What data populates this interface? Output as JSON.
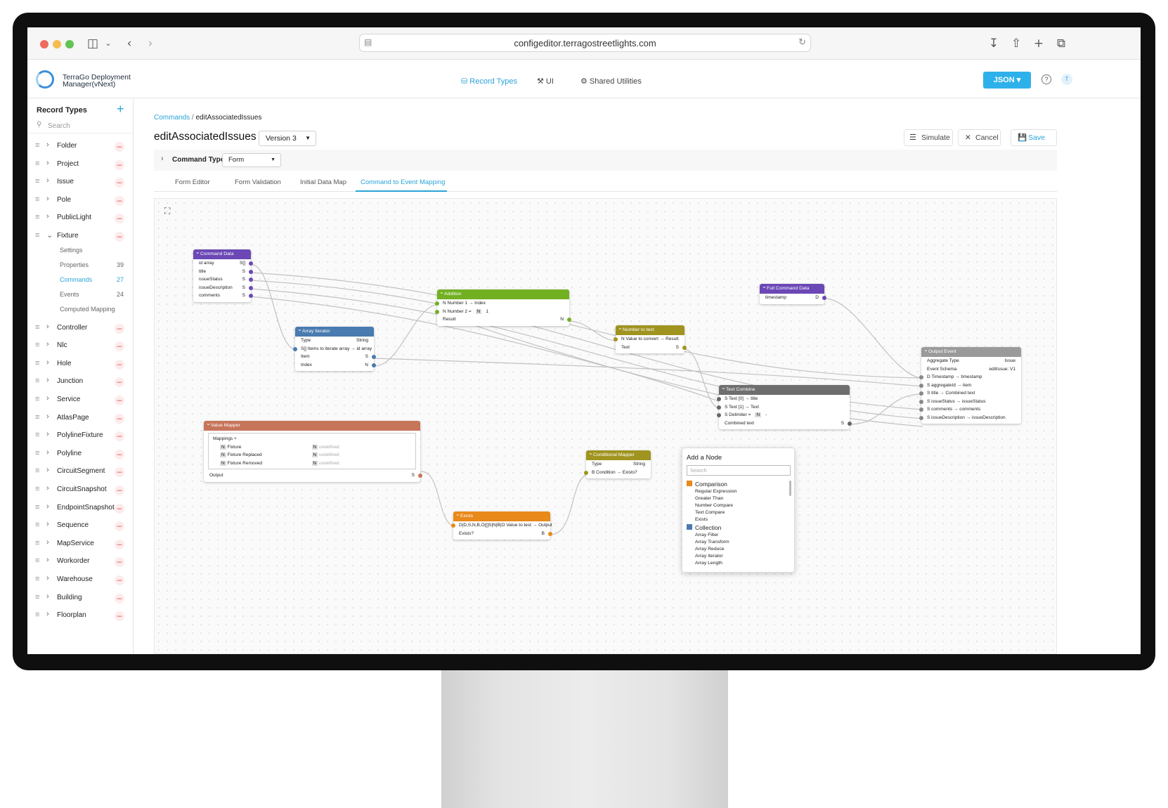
{
  "browser": {
    "url": "configeditor.terragostreetlights.com"
  },
  "app": {
    "brand_line1": "TerraGo Deployment",
    "brand_line2": "Manager(vNext)",
    "nav": [
      "Record Types",
      "UI",
      "Shared Utilities"
    ],
    "json_label": "JSON",
    "avatar": "T"
  },
  "sidebar": {
    "title": "Record Types",
    "search_placeholder": "Search",
    "items": [
      "Folder",
      "Project",
      "Issue",
      "Pole",
      "PublicLight",
      "Fixture"
    ],
    "fixture_children": [
      {
        "label": "Settings",
        "count": ""
      },
      {
        "label": "Properties",
        "count": "39"
      },
      {
        "label": "Commands",
        "count": "27"
      },
      {
        "label": "Events",
        "count": "24"
      },
      {
        "label": "Computed Mapping",
        "count": ""
      }
    ],
    "items_after": [
      "Controller",
      "Nlc",
      "Hole",
      "Junction",
      "Service",
      "AtlasPage",
      "PolylineFixture",
      "Polyline",
      "CircuitSegment",
      "CircuitSnapshot",
      "EndpointSnapshot",
      "Sequence",
      "MapService",
      "Workorder",
      "Warehouse",
      "Building",
      "Floorplan"
    ]
  },
  "main": {
    "breadcrumb_root": "Commands",
    "breadcrumb_sep": " / ",
    "breadcrumb_leaf": "editAssociatedIssues",
    "title": "editAssociatedIssues",
    "version": "Version 3",
    "simulate": "Simulate",
    "cancel": "Cancel",
    "save": "Save",
    "command_type_label": "Command Type",
    "command_type_value": "Form",
    "tabs": [
      "Form Editor",
      "Form Validation",
      "Initial Data Map",
      "Command to Event Mapping"
    ]
  },
  "nodes": {
    "command_data": {
      "title": "Command Data",
      "rows": [
        [
          "id array",
          "S[]"
        ],
        [
          "title",
          "S"
        ],
        [
          "issueStatus",
          "S"
        ],
        [
          "issueDescription",
          "S"
        ],
        [
          "comments",
          "S"
        ]
      ]
    },
    "array_iterator": {
      "title": "Array Iterator",
      "type_label": "Type",
      "type_value": "String",
      "items_row": "S[]  Items to iterate array → id array",
      "rows": [
        [
          "Item",
          "S"
        ],
        [
          "Index",
          "N"
        ]
      ]
    },
    "addition": {
      "title": "Addition",
      "r1": "N   Number 1 → Index",
      "r2_label": "N   Number 2 =",
      "r2_badge": "N",
      "r2_value": "1",
      "result": "Result",
      "result_type": "N"
    },
    "number_to_text": {
      "title": "Number to text",
      "r1": "N   Value to convert → Result",
      "r2": "Text",
      "r2_type": "S"
    },
    "full_command": {
      "title": "Full Command Data",
      "r1": "timestamp",
      "r1_type": "D"
    },
    "text_combine": {
      "title": "Text Combine",
      "r1": "S   Text [0] → title",
      "r2": "S   Text [1] → Text",
      "r3": "S   Delimiter =",
      "r3_badge": "N",
      "r3_value": "-",
      "r4": "Combined text",
      "r4_type": "S"
    },
    "output_event": {
      "title": "Output Event",
      "agg_label": "Aggregate Type",
      "agg_value": "Issue",
      "schema_label": "Event Schema",
      "schema_value": "editIssue: V1",
      "rows": [
        "D   Timestamp → timestamp",
        "S   aggregateId → item",
        "S   title → Combined text",
        "S   issueStatus → issueStatus",
        "S   comments → comments",
        "S   issueDescription → issueDescription"
      ]
    },
    "value_mapper": {
      "title": "Value Mapper",
      "mappings_label": "Mappings +",
      "rows": [
        {
          "badge": "N",
          "value": "Fixture",
          "badge2": "N",
          "value2": "undefined"
        },
        {
          "badge": "N",
          "value": "Fixture Replaced",
          "badge2": "N",
          "value2": "undefined"
        },
        {
          "badge": "N",
          "value": "Fixture Removed",
          "badge2": "N",
          "value2": "undefined"
        }
      ],
      "output": "Output",
      "output_type": "S"
    },
    "conditional": {
      "title": "Conditional Mapper",
      "type_label": "Type",
      "type_value": "String",
      "r1": "B   Condition → Exists?"
    },
    "exists": {
      "title": "Exists",
      "r1": "D|D,S,N,B,O|[]S|N|B|O   Value to test → Output",
      "r2": "Exists?",
      "r2_type": "B"
    }
  },
  "add_node": {
    "title": "Add a Node",
    "search_placeholder": "Search",
    "groups": [
      {
        "name": "Comparison",
        "color": "#e8891a",
        "items": [
          "Regular Expression",
          "Greater Than",
          "Number Compare",
          "Text Compare",
          "Exists"
        ]
      },
      {
        "name": "Collection",
        "color": "#4a7bb0",
        "items": [
          "Array Filter",
          "Array Transform",
          "Array Reduce",
          "Array Iterator",
          "Array Length"
        ]
      }
    ]
  }
}
